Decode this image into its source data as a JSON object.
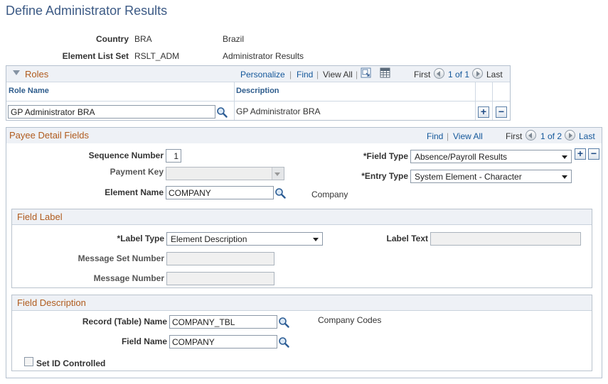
{
  "page": {
    "title": "Define Administrator Results"
  },
  "header": {
    "country_label": "Country",
    "country_code": "BRA",
    "country_name": "Brazil",
    "element_list_label": "Element List Set",
    "element_list_code": "RSLT_ADM",
    "element_list_name": "Administrator Results"
  },
  "roles": {
    "title": "Roles",
    "personalize": "Personalize",
    "find": "Find",
    "view_all": "View All",
    "first": "First",
    "count": "1 of 1",
    "last": "Last",
    "col_role": "Role Name",
    "col_desc": "Description",
    "rows": [
      {
        "role": "GP Administrator BRA",
        "description": "GP Administrator BRA"
      }
    ]
  },
  "payee": {
    "title": "Payee Detail Fields",
    "find": "Find",
    "view_all": "View All",
    "first": "First",
    "count": "1 of 2",
    "last": "Last",
    "sequence_label": "Sequence Number",
    "sequence_value": "1",
    "payment_key_label": "Payment Key",
    "payment_key_value": "",
    "element_name_label": "Element Name",
    "element_name_value": "COMPANY",
    "element_name_desc": "Company",
    "field_type_label": "*Field Type",
    "field_type_value": "Absence/Payroll Results",
    "entry_type_label": "*Entry Type",
    "entry_type_value": "System Element - Character"
  },
  "field_label": {
    "title": "Field Label",
    "label_type_label": "*Label Type",
    "label_type_value": "Element Description",
    "label_text_label": "Label Text",
    "label_text_value": "",
    "msg_set_label": "Message Set Number",
    "msg_set_value": "",
    "msg_num_label": "Message Number",
    "msg_num_value": ""
  },
  "field_description": {
    "title": "Field Description",
    "record_label": "Record (Table) Name",
    "record_value": "COMPANY_TBL",
    "record_desc": "Company Codes",
    "field_name_label": "Field Name",
    "field_name_value": "COMPANY",
    "setid_label": "Set ID Controlled",
    "setid_checked": false
  },
  "icons": {
    "lookup": "magnifier-icon",
    "add": "plus-icon",
    "delete": "minus-icon",
    "collapse": "triangle-down-icon",
    "zoom": "zoom-grid-icon",
    "download": "spreadsheet-icon"
  },
  "colors": {
    "title": "#3c5a85",
    "section_title": "#b05b1d",
    "link": "#13579a",
    "grid_border": "#b5c1cf",
    "grid_header_bg": "#eef1f6"
  }
}
